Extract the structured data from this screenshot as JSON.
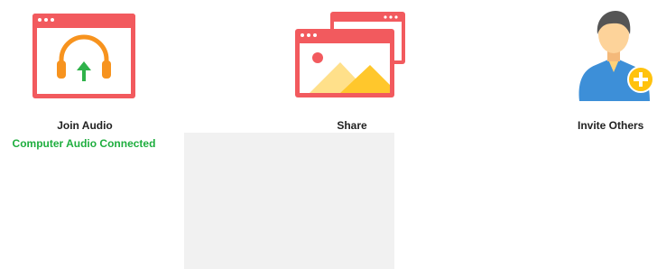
{
  "actions": {
    "join_audio": {
      "label": "Join Audio",
      "status": "Computer Audio Connected",
      "icon": "headphones-icon"
    },
    "share": {
      "label": "Share",
      "icon": "share-screen-icon"
    },
    "invite": {
      "label": "Invite Others",
      "icon": "invite-user-icon"
    }
  },
  "colors": {
    "window_red": "#f25a5e",
    "headphones_orange": "#f7931e",
    "connected_green": "#1fae3f",
    "mountain_yellow": "#ffc72c",
    "person_blue": "#3d8fd8",
    "plus_yellow": "#ffc20e"
  }
}
